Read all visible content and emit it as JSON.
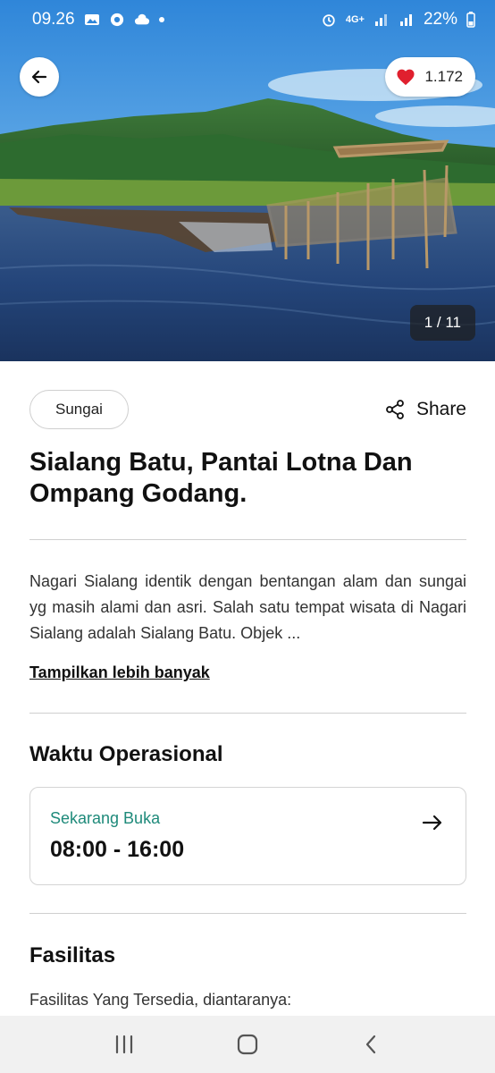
{
  "status_bar": {
    "time": "09.26",
    "network": "4G+",
    "battery": "22%",
    "left_icons": [
      "image-icon",
      "chrome-icon",
      "cloud-icon",
      "dot-icon"
    ],
    "right_icons": [
      "alarm-icon",
      "network-icon",
      "signal-icon",
      "signal-icon",
      "battery-icon"
    ]
  },
  "hero": {
    "like_count": "1.172",
    "image_counter": "1 / 11"
  },
  "tag": "Sungai",
  "share_label": "Share",
  "title": "Sialang Batu, Pantai Lotna Dan Ompang Godang.",
  "description": "Nagari Sialang identik dengan bentangan alam dan sungai yg masih alami dan asri. Salah satu tempat wisata di Nagari Sialang adalah Sialang Batu. Objek ...",
  "show_more": "Tampilkan lebih banyak",
  "operational": {
    "heading": "Waktu Operasional",
    "status": "Sekarang Buka",
    "hours": "08:00 - 16:00"
  },
  "facilities": {
    "heading": "Fasilitas",
    "intro": "Fasilitas Yang Tersedia, diantaranya:"
  },
  "colors": {
    "open_status": "#1e8a7a",
    "heart": "#e0202e",
    "nav_bg": "#f1f1f1"
  }
}
